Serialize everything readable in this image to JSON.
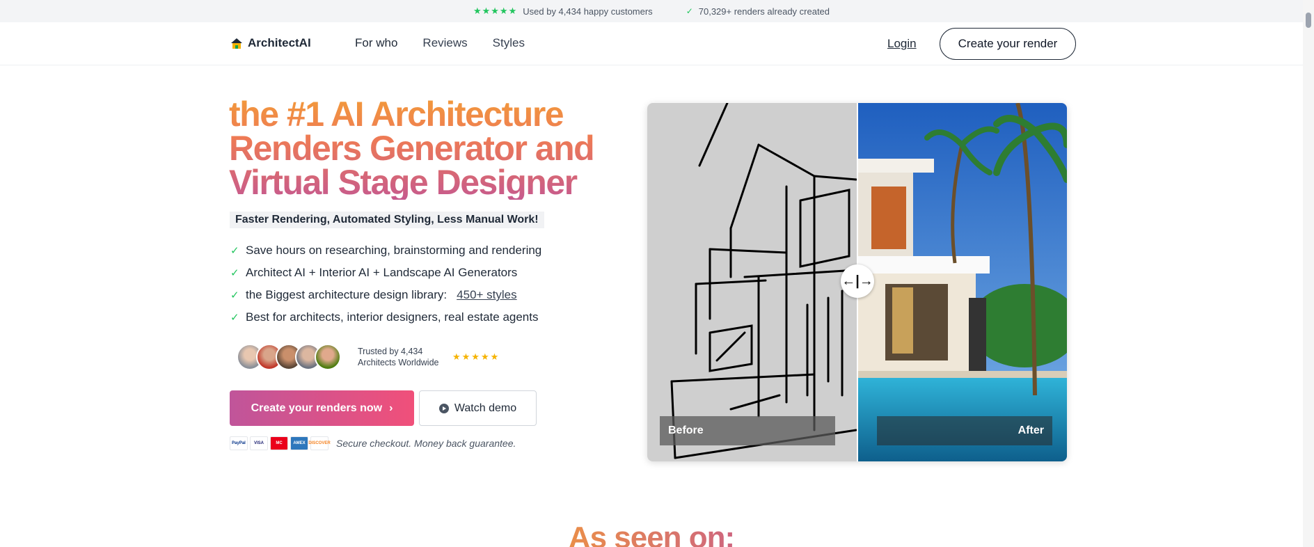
{
  "topbar": {
    "stars": "★★★★★",
    "customers": "Used by 4,434 happy customers",
    "check": "✓",
    "renders": "70,329+ renders already created"
  },
  "nav": {
    "logo_text": "ArchitectAI",
    "links": [
      "For who",
      "Reviews",
      "Styles"
    ],
    "login": "Login",
    "create": "Create your render"
  },
  "hero": {
    "title": "the #1 AI Architecture Renders Generator and Virtual Stage Designer",
    "subline": "Faster Rendering, Automated Styling, Less Manual Work!",
    "bullets": [
      "Save hours on researching, brainstorming and rendering",
      "Architect AI + Interior AI + Landscape AI Generators",
      "the Biggest architecture design library:",
      "Best for architects, interior designers, real estate agents"
    ],
    "bullet_link": "450+ styles",
    "trusted_line1": "Trusted by 4,434",
    "trusted_line2": "Architects Worldwide",
    "trusted_stars": "★★★★★",
    "cta": "Create your renders now",
    "cta_arrow": "›",
    "demo": "Watch demo",
    "payments": [
      "PayPal",
      "VISA",
      "MC",
      "AMEX",
      "DISCOVER"
    ],
    "secure": "Secure checkout. Money back guarantee."
  },
  "compare": {
    "before": "Before",
    "after": "After",
    "handle": "←|→"
  },
  "section": {
    "seen_on": "As seen on:"
  },
  "colors": {
    "accent_orange": "#f29a3a",
    "accent_pink": "#c65a8e",
    "cta_gradient_end": "#f0507a",
    "check_green": "#22c55e",
    "star_yellow": "#f5b301"
  }
}
